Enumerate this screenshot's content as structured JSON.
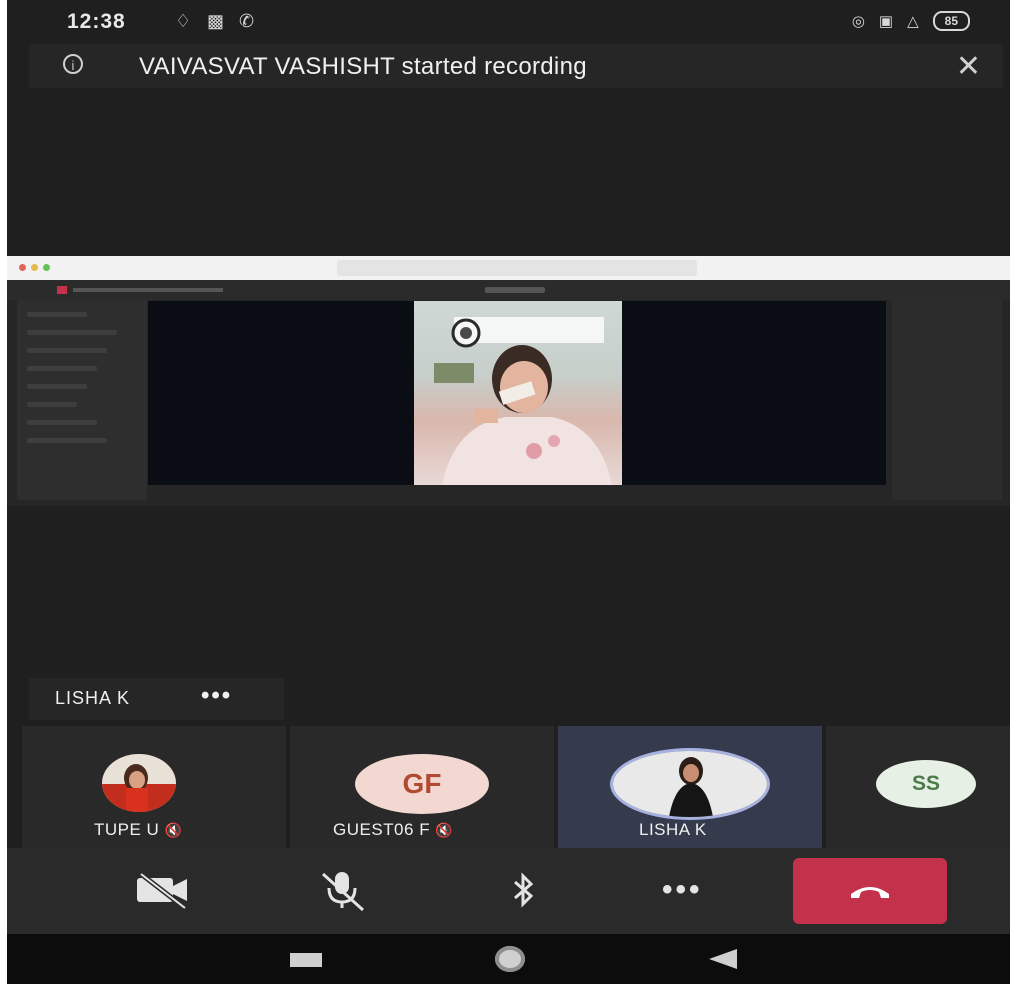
{
  "status_bar": {
    "time": "12:38",
    "battery": "85"
  },
  "recording_banner": {
    "text": "VAIVASVAT VASHISHT started recording"
  },
  "pinned": {
    "name": "LISHA K",
    "more": "•••"
  },
  "participants": [
    {
      "name": "TUPE U",
      "avatar": "photo",
      "muted": true
    },
    {
      "name": "GUEST06 F",
      "initials": "GF",
      "muted": true
    },
    {
      "name": "LISHA K",
      "avatar": "photo",
      "active": true
    },
    {
      "name": "",
      "initials": "SS"
    }
  ],
  "controls": {
    "camera": "camera-off-icon",
    "mic": "mic-off-icon",
    "audio": "bluetooth-icon",
    "more": "•••",
    "hangup": "hang-up-icon"
  },
  "colors": {
    "background": "#1f1f1f",
    "hangup": "#c4314b",
    "active_tile": "#353a4c",
    "guest_avatar": "#f3d8d2",
    "ss_avatar": "#e7f0e4"
  }
}
